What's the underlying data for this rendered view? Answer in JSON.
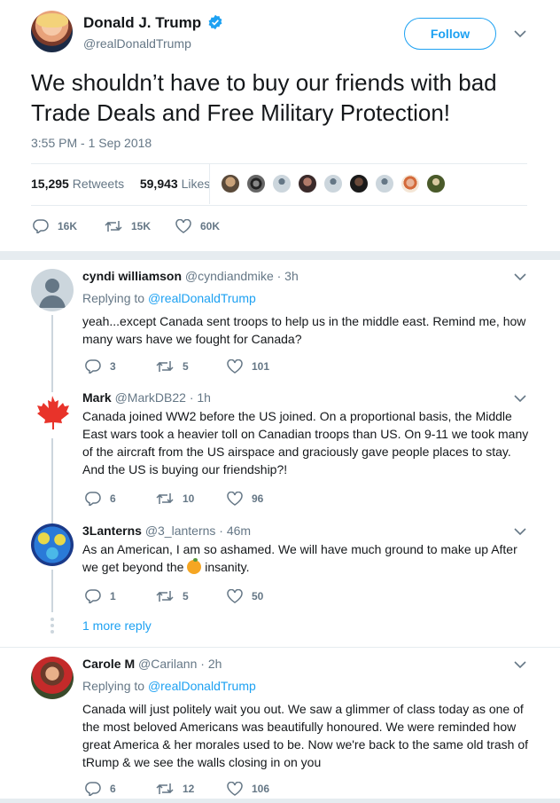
{
  "tweet": {
    "author_name": "Donald J. Trump",
    "author_handle": "@realDonaldTrump",
    "follow_label": "Follow",
    "text": "We shouldn’t have to buy our friends with bad Trade Deals and Free Military Protection!",
    "timestamp": "3:55 PM - 1 Sep 2018",
    "retweets_count": "15,295",
    "retweets_label": "Retweets",
    "likes_count": "59,943",
    "likes_label": "Likes",
    "replies": "16K",
    "retweets": "15K",
    "likes": "60K"
  },
  "colors": {
    "accent": "#1da1f2",
    "muted": "#657786",
    "divider": "#e6ecf0"
  },
  "replies": [
    {
      "name": "cyndi williamson",
      "handle": "@cyndiandmike",
      "time": "· 3h",
      "replying_prefix": "Replying to",
      "replying_to": "@realDonaldTrump",
      "text": "yeah...except Canada sent troops to help us in the middle east. Remind me, how many wars have we fought for Canada?",
      "replies": "3",
      "retweets": "5",
      "likes": "101"
    },
    {
      "name": "Mark",
      "handle": "@MarkDB22",
      "time": "· 1h",
      "text": "Canada joined WW2 before the US joined.  On a proportional basis, the Middle East wars took a heavier toll on Canadian troops than US.  On 9-11 we took many of the aircraft from the US airspace and graciously gave people places to stay.  And the US is buying our friendship?!",
      "replies": "6",
      "retweets": "10",
      "likes": "96"
    },
    {
      "name": "3Lanterns",
      "handle": "@3_lanterns",
      "time": "· 46m",
      "text_before": "As an American, I am so ashamed.  We will have much ground to make up After we get beyond the",
      "text_after": "insanity.",
      "replies": "1",
      "retweets": "5",
      "likes": "50"
    },
    {
      "name": "Carole M",
      "handle": "@Carilann",
      "time": "· 2h",
      "replying_prefix": "Replying to",
      "replying_to": "@realDonaldTrump",
      "text": "Canada will just politely wait you out.  We saw a glimmer of class today as one of the most beloved Americans was beautifully honoured. We were reminded how great America & her morales used to be. Now we're back to the same old trash of tRump & we see the walls closing in on you",
      "replies": "6",
      "retweets": "12",
      "likes": "106"
    }
  ],
  "more_replies_label": "1 more reply"
}
